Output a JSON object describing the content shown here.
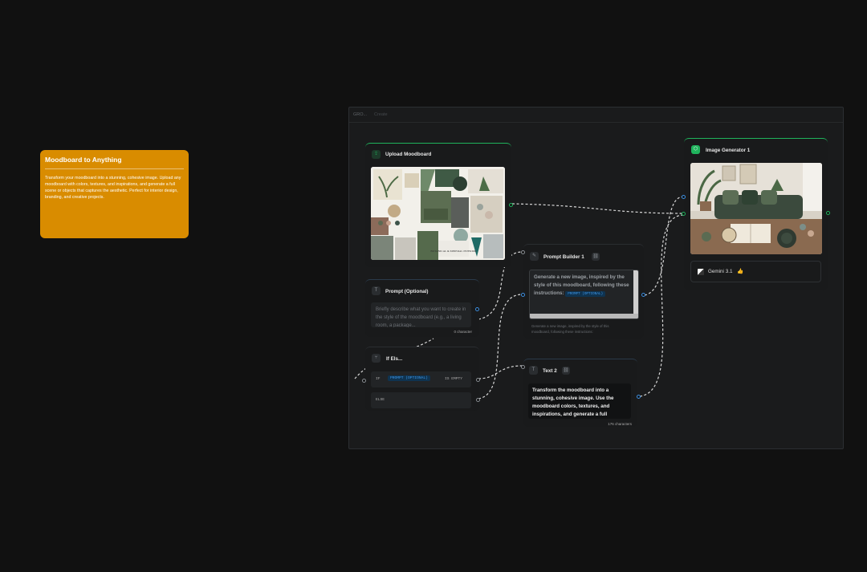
{
  "sticky_note": {
    "title": "Moodboard to Anything",
    "body": "Transform your moodboard into a stunning, cohesive image. Upload any moodboard with colors, textures, and inspirations, and generate a full scene or objects that captures the aesthetic. Perfect for interior design, branding, and creative projects."
  },
  "group": {
    "name": "GRO...",
    "subtitle": "Create"
  },
  "upload_node": {
    "title": "Upload Moodboard",
    "image_caption": "BOTANICAL & MINERAL INTERIOR"
  },
  "prompt_node": {
    "title": "Prompt (Optional)",
    "placeholder": "Briefly describe what you want to create in the style of the moodboard (e.g., a living room, a package...",
    "char_count": "0 character"
  },
  "ifelse_node": {
    "title": "If Els...",
    "if_keyword": "IF",
    "if_variable": "PROMPT (OPTIONAL)",
    "condition": "IS EMPTY",
    "else_keyword": "ELSE"
  },
  "prompt_builder_node": {
    "title": "Prompt Builder 1",
    "template_text": "Generate a new image, inspired by the style of this moodboard, following these instructions:",
    "variable": "PROMPT (OPTIONAL)",
    "preview": "Generate a new image, inspired by the style of this moodboard, following these instructions:"
  },
  "text_node": {
    "title": "Text 2",
    "content": "Transform the moodboard into a stunning, cohesive image. Use the moodboard colors, textures, and inspirations, and generate a full",
    "char_count": "176 characters"
  },
  "image_gen_node": {
    "title": "Image Generator 1",
    "model": "Gemini 3.1",
    "model_emoji": "👍"
  },
  "colors": {
    "accent_green": "#1fb35c",
    "accent_blue": "#3d8fe0",
    "note_orange": "#d98c00",
    "canvas": "#111111"
  }
}
